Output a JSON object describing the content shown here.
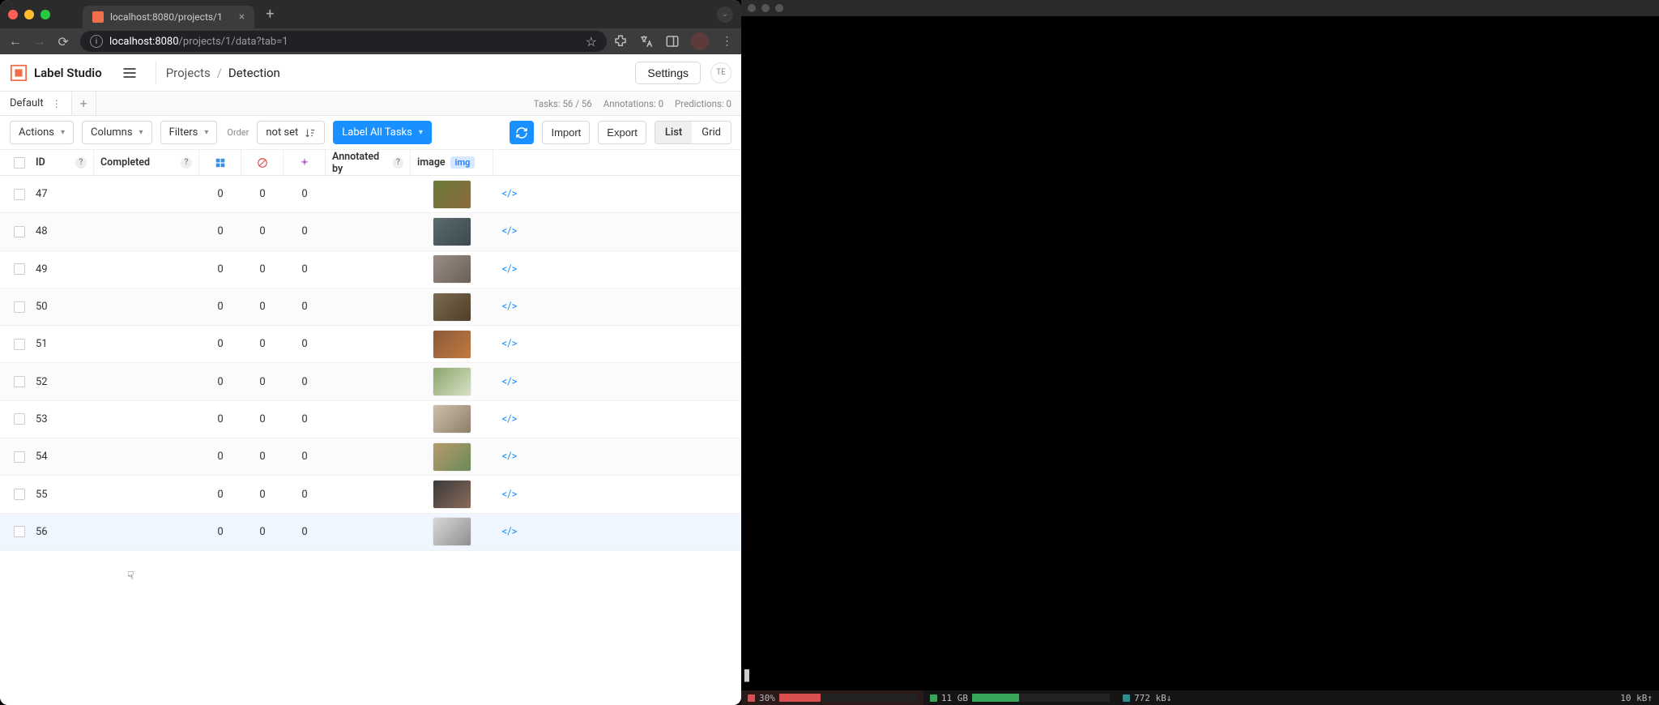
{
  "browser": {
    "tab_title": "localhost:8080/projects/1",
    "url_host": "localhost:8080",
    "url_path": "/projects/1/data?tab=1"
  },
  "app": {
    "brand": "Label Studio",
    "breadcrumb_root": "Projects",
    "breadcrumb_current": "Detection",
    "settings_label": "Settings",
    "user_initials": "TE"
  },
  "view_tab": {
    "name": "Default"
  },
  "stats": {
    "tasks": "Tasks: 56 / 56",
    "annotations": "Annotations: 0",
    "predictions": "Predictions: 0"
  },
  "toolbar": {
    "actions": "Actions",
    "columns": "Columns",
    "filters": "Filters",
    "order_label": "Order",
    "order_value": "not set",
    "label_all": "Label All Tasks",
    "import": "Import",
    "export": "Export",
    "list": "List",
    "grid": "Grid"
  },
  "columns": {
    "id": "ID",
    "completed": "Completed",
    "annotated_by": "Annotated by",
    "image": "image",
    "image_badge": "img"
  },
  "rows": [
    {
      "id": "47",
      "c1": "0",
      "c2": "0",
      "c3": "0",
      "thumb_bg": "linear-gradient(135deg,#6b7a3a,#8a6b3f)"
    },
    {
      "id": "48",
      "c1": "0",
      "c2": "0",
      "c3": "0",
      "thumb_bg": "linear-gradient(135deg,#5a6a6f,#3b4a4f)"
    },
    {
      "id": "49",
      "c1": "0",
      "c2": "0",
      "c3": "0",
      "thumb_bg": "linear-gradient(135deg,#9a8d85,#6b5f57)"
    },
    {
      "id": "50",
      "c1": "0",
      "c2": "0",
      "c3": "0",
      "thumb_bg": "linear-gradient(135deg,#7a6a4f,#4f3f2a)"
    },
    {
      "id": "51",
      "c1": "0",
      "c2": "0",
      "c3": "0",
      "thumb_bg": "linear-gradient(135deg,#8a5a3a,#c27a3f)"
    },
    {
      "id": "52",
      "c1": "0",
      "c2": "0",
      "c3": "0",
      "thumb_bg": "linear-gradient(135deg,#8aa56a,#d8e0c8)"
    },
    {
      "id": "53",
      "c1": "0",
      "c2": "0",
      "c3": "0",
      "thumb_bg": "linear-gradient(135deg,#cbbfa8,#8f7f6a)"
    },
    {
      "id": "54",
      "c1": "0",
      "c2": "0",
      "c3": "0",
      "thumb_bg": "linear-gradient(135deg,#b89a6a,#6a8a5a)"
    },
    {
      "id": "55",
      "c1": "0",
      "c2": "0",
      "c3": "0",
      "thumb_bg": "linear-gradient(135deg,#3a3a3a,#8a6a5a)"
    },
    {
      "id": "56",
      "c1": "0",
      "c2": "0",
      "c3": "0",
      "thumb_bg": "linear-gradient(135deg,#d8d8d8,#8f8f8f)",
      "hover": true
    }
  ],
  "statusbar": {
    "cpu_label": "30%",
    "cpu_fill": "30%",
    "mem_label": "11 GB",
    "mem_fill": "34%",
    "net_down": "772 kB↓",
    "net_up": "10 kB↑"
  }
}
